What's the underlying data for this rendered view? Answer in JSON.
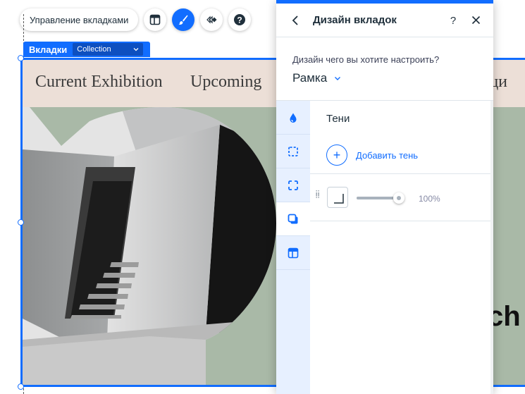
{
  "toolbar": {
    "manage_tabs_label": "Управление вкладками",
    "icons": [
      "layout-icon",
      "brush-icon",
      "animation-icon",
      "help-icon"
    ],
    "active_icon": "brush-icon"
  },
  "element_label": {
    "name": "Вкладки",
    "dropdown_value": "Collection"
  },
  "canvas": {
    "tabs": [
      "Current Exhibition",
      "Upcoming",
      "зици"
    ],
    "heading_fragment": "ch",
    "colors": {
      "tabs_bar": "#ecdfd7",
      "content_bg": "#a9b9a7",
      "selection": "#116dff"
    }
  },
  "panel": {
    "title": "Дизайн вкладок",
    "design_question": "Дизайн чего вы хотите настроить?",
    "design_target": "Рамка",
    "rail_items": [
      "fill-icon",
      "border-icon",
      "corners-icon",
      "shadow-icon",
      "layout-icon"
    ],
    "active_rail_item": "shadow-icon",
    "section_title": "Тени",
    "add_shadow_label": "Добавить тень",
    "shadow_opacity": {
      "value": 100,
      "display": "100%"
    },
    "accent": "#116dff"
  }
}
